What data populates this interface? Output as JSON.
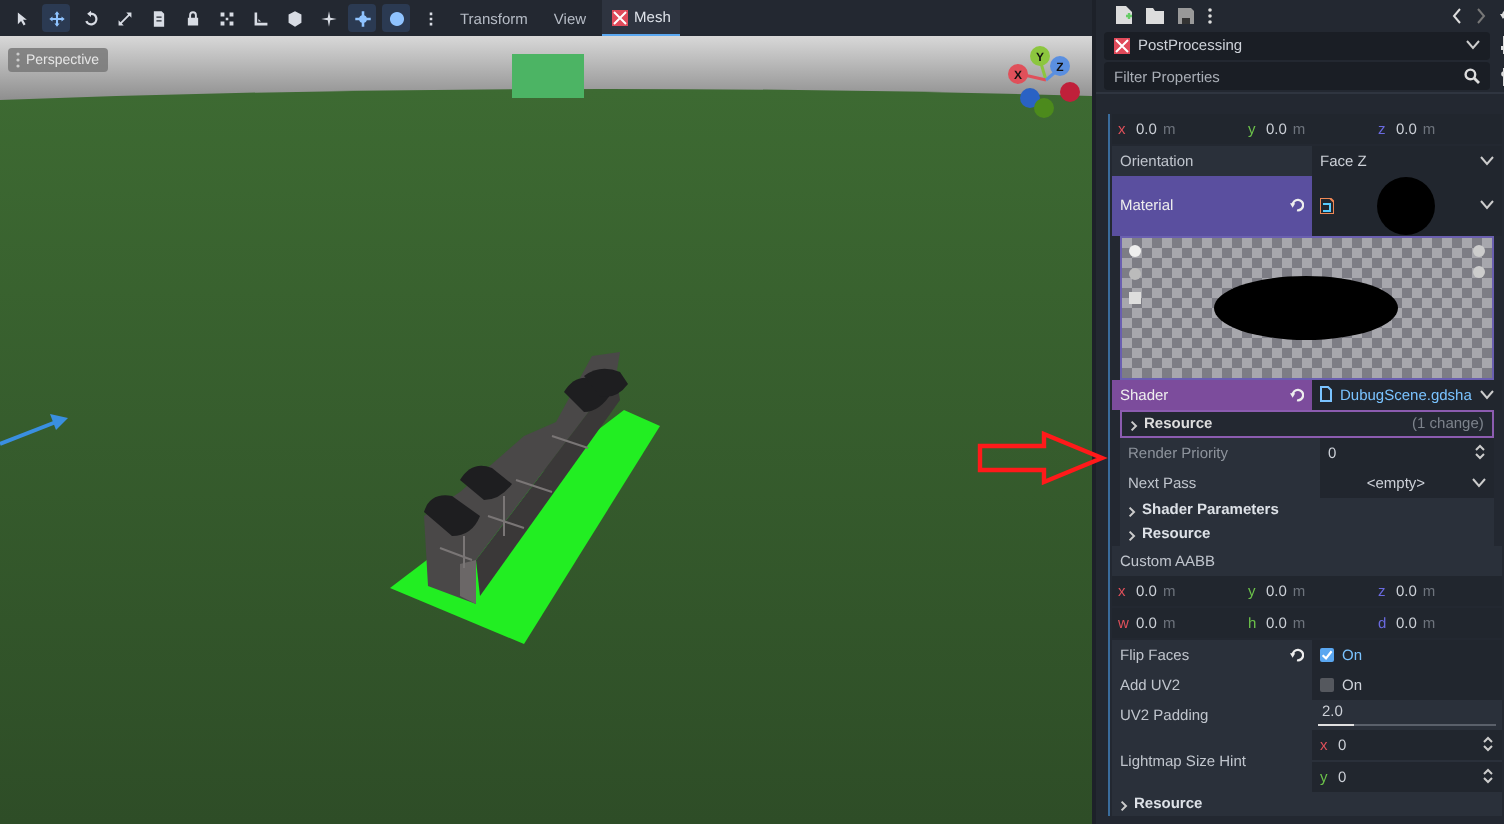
{
  "toolbar": {
    "tools": [
      {
        "kind": "select",
        "selected": false
      },
      {
        "kind": "move",
        "selected": true
      },
      {
        "kind": "rotate",
        "selected": false
      },
      {
        "kind": "scale",
        "selected": false
      },
      {
        "kind": "list",
        "selected": false
      },
      {
        "kind": "lock",
        "selected": false
      },
      {
        "kind": "group",
        "selected": false
      },
      {
        "kind": "ruler",
        "selected": false
      },
      {
        "kind": "cube",
        "selected": false
      },
      {
        "kind": "sparkle",
        "selected": false
      },
      {
        "kind": "local",
        "selected": true
      },
      {
        "kind": "globe",
        "selected": true
      },
      {
        "kind": "more",
        "selected": false
      }
    ],
    "menus": [
      {
        "label": "Transform",
        "selected": false,
        "icon": false
      },
      {
        "label": "View",
        "selected": false,
        "icon": false
      },
      {
        "label": "Mesh",
        "selected": true,
        "icon": true
      }
    ]
  },
  "viewport": {
    "perspective_button": "Perspective",
    "gizmo": [
      {
        "label": "Y"
      },
      {
        "label": "X"
      },
      {
        "label": "Z"
      }
    ]
  },
  "inspector": {
    "node": "PostProcessing",
    "filter": {
      "placeholder": "Filter Properties"
    },
    "properties": [
      {
        "kind": "vector",
        "fields": [
          {
            "axis": "x",
            "value": "0.0",
            "unit": "m"
          },
          {
            "axis": "y",
            "value": "0.0",
            "unit": "m"
          },
          {
            "axis": "z",
            "value": "0.0",
            "unit": "m"
          }
        ]
      },
      {
        "kind": "dropdown",
        "label": "Orientation",
        "value": "Face Z"
      },
      {
        "kind": "material",
        "label": "Material",
        "modified": true,
        "children": [
          {
            "kind": "preview"
          },
          {
            "kind": "shader",
            "label": "Shader",
            "value": "DubugScene.gdsha",
            "modified": true
          },
          {
            "kind": "subheader",
            "label": "Resource",
            "note": "(1 change)"
          },
          {
            "kind": "spin",
            "label": "Render Priority",
            "value": "0"
          },
          {
            "kind": "dropdown",
            "label": "Next Pass",
            "value": "<empty>"
          },
          {
            "kind": "section",
            "label": "Shader Parameters"
          },
          {
            "kind": "section",
            "label": "Resource"
          }
        ]
      },
      {
        "kind": "label",
        "label": "Custom AABB"
      },
      {
        "kind": "vector",
        "fields": [
          {
            "axis": "x",
            "value": "0.0",
            "unit": "m"
          },
          {
            "axis": "y",
            "value": "0.0",
            "unit": "m"
          },
          {
            "axis": "z",
            "value": "0.0",
            "unit": "m"
          }
        ]
      },
      {
        "kind": "vector",
        "fields": [
          {
            "axis": "w",
            "value": "0.0",
            "unit": "m"
          },
          {
            "axis": "h",
            "value": "0.0",
            "unit": "m"
          },
          {
            "axis": "d",
            "value": "0.0",
            "unit": "m"
          }
        ]
      },
      {
        "kind": "check",
        "label": "Flip Faces",
        "value": "On",
        "checked": true,
        "modified": true
      },
      {
        "kind": "check",
        "label": "Add UV2",
        "value": "On",
        "checked": false,
        "modified": false
      },
      {
        "kind": "slider",
        "label": "UV2 Padding",
        "value": "2.0",
        "level": 0.2
      },
      {
        "kind": "spin2",
        "label": "Lightmap Size Hint",
        "fields": [
          {
            "axis": "x",
            "value": "0"
          },
          {
            "axis": "y",
            "value": "0"
          }
        ]
      },
      {
        "kind": "section",
        "label": "Resource"
      }
    ]
  }
}
